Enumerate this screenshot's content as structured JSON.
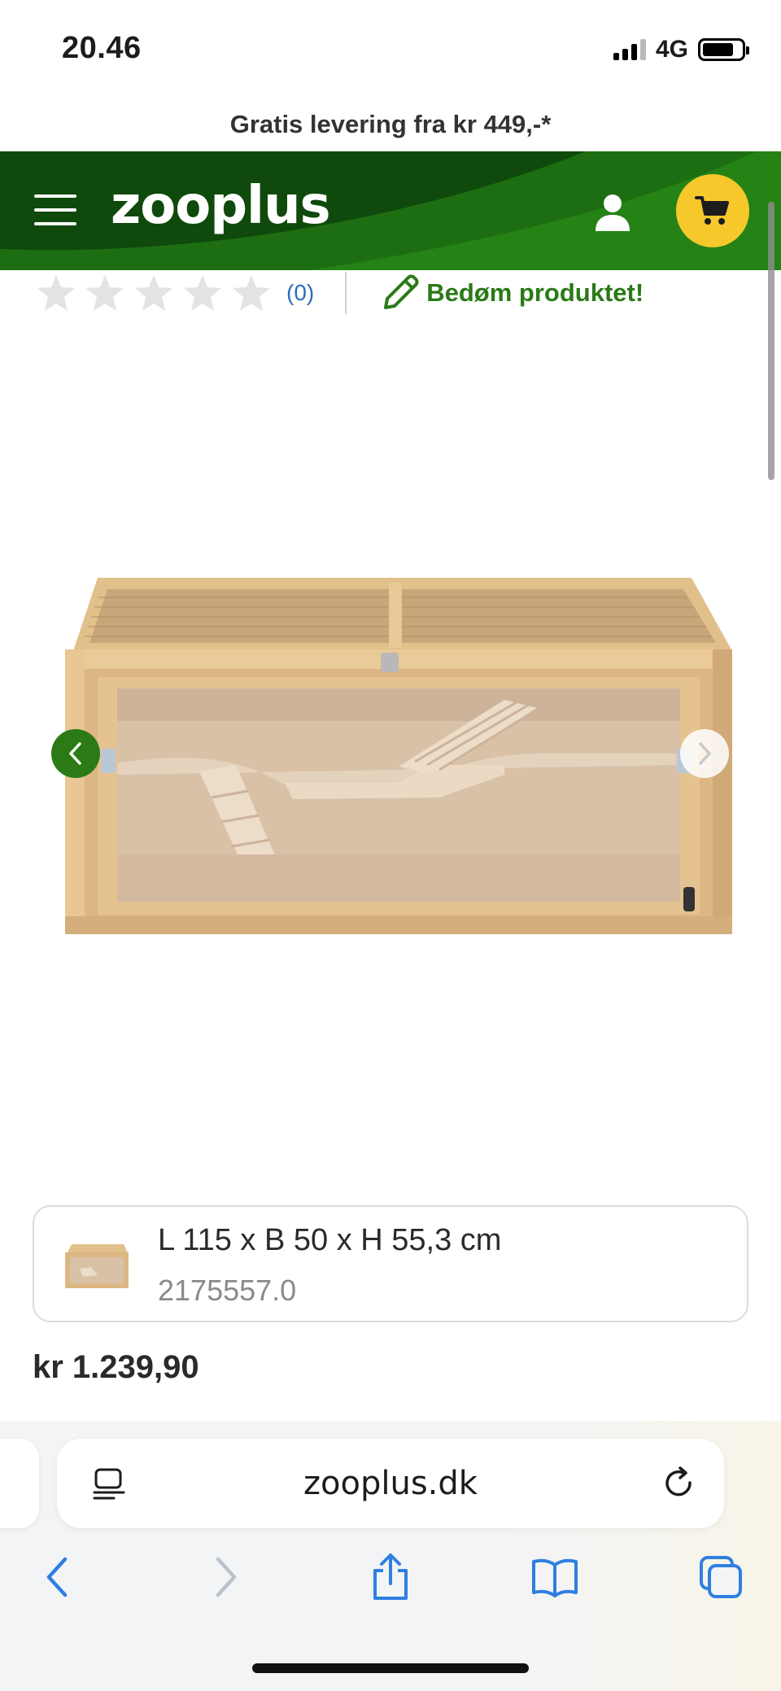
{
  "status_bar": {
    "time": "20.46",
    "network": "4G"
  },
  "promo": {
    "text": "Gratis levering fra kr 449,-*"
  },
  "header": {
    "logo": "zooplus",
    "menu_icon": "hamburger-icon",
    "user_icon": "user-icon",
    "cart_icon": "cart-icon",
    "brand_color": "#1f6e12",
    "accent_color": "#f7c82c"
  },
  "rating": {
    "stars_filled": 0,
    "stars_total": 5,
    "count": "(0)",
    "rate_link": "Bedøm produktet!"
  },
  "product": {
    "image_alt": "Wooden hamster cage",
    "carousel_prev_icon": "chevron-left-icon",
    "carousel_next_icon": "chevron-right-icon"
  },
  "variant": {
    "size": "L 115 x B 50 x H 55,3 cm",
    "code": "2175557.0"
  },
  "price": "kr 1.239,90",
  "browser": {
    "url": "zooplus.dk",
    "icons": [
      "reader-icon",
      "reload-icon",
      "back-icon",
      "forward-icon",
      "share-icon",
      "bookmarks-icon",
      "tabs-icon"
    ],
    "tint_color": "#2f7fe0"
  }
}
